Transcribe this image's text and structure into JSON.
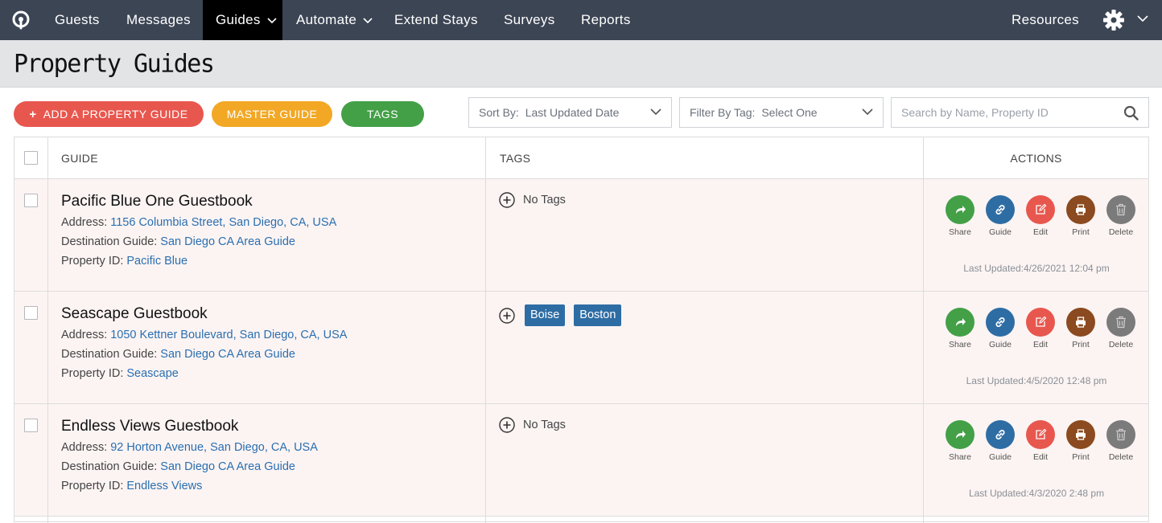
{
  "nav": {
    "items": [
      {
        "label": "Guests"
      },
      {
        "label": "Messages"
      },
      {
        "label": "Guides"
      },
      {
        "label": "Automate"
      },
      {
        "label": "Extend Stays"
      },
      {
        "label": "Surveys"
      },
      {
        "label": "Reports"
      }
    ],
    "resources_label": "Resources",
    "active": "Guides"
  },
  "page": {
    "title": "Property Guides"
  },
  "toolbar": {
    "add_label": "ADD A PROPERTY GUIDE",
    "master_label": "MASTER GUIDE",
    "tags_label": "TAGS",
    "sort_label": "Sort By:",
    "sort_value": "Last Updated Date",
    "filter_label": "Filter By Tag:",
    "filter_value": "Select One",
    "search_placeholder": "Search by Name, Property ID"
  },
  "table": {
    "headers": {
      "guide": "GUIDE",
      "tags": "TAGS",
      "actions": "ACTIONS"
    },
    "field_labels": {
      "address": "Address:",
      "destination": "Destination Guide:",
      "property_id": "Property ID:"
    },
    "action_labels": {
      "share": "Share",
      "guide": "Guide",
      "edit": "Edit",
      "print": "Print",
      "delete": "Delete"
    },
    "no_tags_label": "No Tags",
    "rows": [
      {
        "title": "Pacific Blue One Guestbook",
        "address": "1156 Columbia Street, San Diego, CA, USA",
        "destination": "San Diego CA Area Guide",
        "property_id": "Pacific Blue",
        "tags": [],
        "last_updated": "Last Updated:4/26/2021 12:04 pm"
      },
      {
        "title": "Seascape Guestbook",
        "address": "1050 Kettner Boulevard, San Diego, CA, USA",
        "destination": "San Diego CA Area Guide",
        "property_id": "Seascape",
        "tags": [
          "Boise",
          "Boston"
        ],
        "last_updated": "Last Updated:4/5/2020 12:48 pm"
      },
      {
        "title": "Endless Views Guestbook",
        "address": "92 Horton Avenue, San Diego, CA, USA",
        "destination": "San Diego CA Area Guide",
        "property_id": "Endless Views",
        "tags": [],
        "last_updated": "Last Updated:4/3/2020 2:48 pm"
      }
    ]
  },
  "colors": {
    "nav_bg": "#3c4554",
    "add": "#e8574e",
    "master": "#f2a825",
    "tags": "#43a047",
    "share": "#43a047",
    "guide": "#2e6da4",
    "edit": "#e8574e",
    "print": "#8b4a1f",
    "delete": "#7b7b7b",
    "link": "#2a6fb0"
  }
}
